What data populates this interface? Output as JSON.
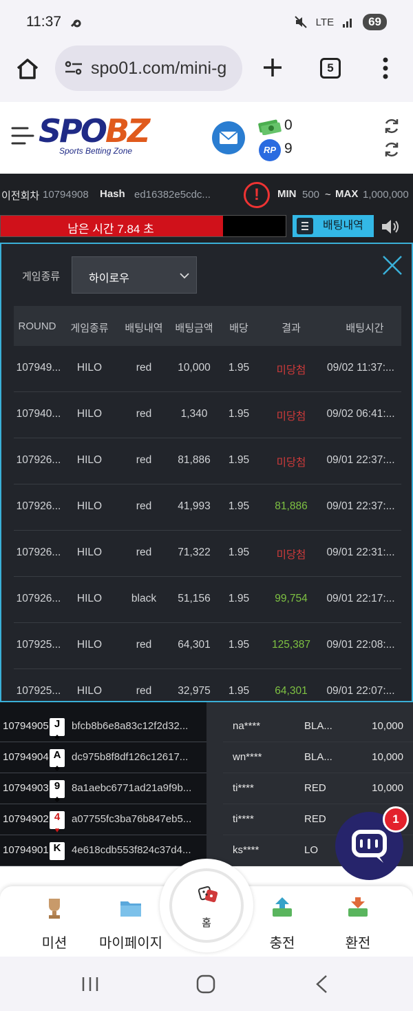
{
  "status_bar": {
    "time": "11:37",
    "network": "LTE",
    "battery": "69"
  },
  "browser": {
    "url": "spo01.com/mini-g",
    "tab_count": "5"
  },
  "header": {
    "logo_spo": "SPO",
    "logo_bz": "BZ",
    "logo_tagline": "Sports Betting Zone",
    "money_value": "0",
    "rp_icon_label": "RP",
    "rp_value": "9"
  },
  "game_info": {
    "prev_round_label": "이전회차",
    "prev_round_value": "10794908",
    "hash_label": "Hash",
    "hash_value": "ed16382e5cdc...",
    "min_label": "MIN",
    "min_value": "500",
    "range_sep": "~",
    "max_label": "MAX",
    "max_value": "1,000,000"
  },
  "timer": {
    "text": "남은 시간 7.84 초",
    "fill_fraction": 0.78
  },
  "history_button": {
    "label": "배팅내역"
  },
  "modal": {
    "game_type_label": "게임종류",
    "game_type_selected": "하이로우",
    "columns": [
      "ROUND",
      "게임종류",
      "배팅내역",
      "배팅금액",
      "배당",
      "결과",
      "배팅시간"
    ],
    "rows": [
      {
        "round": "107949...",
        "game": "HILO",
        "bet": "red",
        "amount": "10,000",
        "odds": "1.95",
        "result": "미당첨",
        "result_type": "lose",
        "time": "09/02 11:37:..."
      },
      {
        "round": "107940...",
        "game": "HILO",
        "bet": "red",
        "amount": "1,340",
        "odds": "1.95",
        "result": "미당첨",
        "result_type": "lose",
        "time": "09/02 06:41:..."
      },
      {
        "round": "107926...",
        "game": "HILO",
        "bet": "red",
        "amount": "81,886",
        "odds": "1.95",
        "result": "미당첨",
        "result_type": "lose",
        "time": "09/01 22:37:..."
      },
      {
        "round": "107926...",
        "game": "HILO",
        "bet": "red",
        "amount": "41,993",
        "odds": "1.95",
        "result": "81,886",
        "result_type": "win",
        "time": "09/01 22:37:..."
      },
      {
        "round": "107926...",
        "game": "HILO",
        "bet": "red",
        "amount": "71,322",
        "odds": "1.95",
        "result": "미당첨",
        "result_type": "lose",
        "time": "09/01 22:31:..."
      },
      {
        "round": "107926...",
        "game": "HILO",
        "bet": "black",
        "amount": "51,156",
        "odds": "1.95",
        "result": "99,754",
        "result_type": "win",
        "time": "09/01 22:17:..."
      },
      {
        "round": "107925...",
        "game": "HILO",
        "bet": "red",
        "amount": "64,301",
        "odds": "1.95",
        "result": "125,387",
        "result_type": "win",
        "time": "09/01 22:08:..."
      },
      {
        "round": "107925...",
        "game": "HILO",
        "bet": "red",
        "amount": "32,975",
        "odds": "1.95",
        "result": "64,301",
        "result_type": "win",
        "time": "09/01 22:07:..."
      }
    ]
  },
  "prev_results": [
    {
      "round": "10794905",
      "card": "J",
      "suit": "♣",
      "red": false,
      "hash": "bfcb8b6e8a83c12f2d32..."
    },
    {
      "round": "10794904",
      "card": "A",
      "suit": "♣",
      "red": false,
      "hash": "dc975b8f8df126c12617..."
    },
    {
      "round": "10794903",
      "card": "9",
      "suit": "♣",
      "red": false,
      "hash": "8a1aebc6771ad21a9f9b..."
    },
    {
      "round": "10794902",
      "card": "4",
      "suit": "♥",
      "red": true,
      "hash": "a07755fc3ba76b847eb5..."
    },
    {
      "round": "10794901",
      "card": "K",
      "suit": "",
      "red": false,
      "hash": "4e618cdb553f824c37d4..."
    }
  ],
  "live_bets": [
    {
      "user": "na****",
      "pick": "BLA...",
      "amount": "10,000"
    },
    {
      "user": "wn****",
      "pick": "BLA...",
      "amount": "10,000"
    },
    {
      "user": "ti****",
      "pick": "RED",
      "amount": "10,000"
    },
    {
      "user": "ti****",
      "pick": "RED",
      "amount": ""
    },
    {
      "user": "ks****",
      "pick": "LO",
      "amount": ""
    }
  ],
  "chat": {
    "badge": "1"
  },
  "bottom_nav": {
    "mission": "미션",
    "mypage": "마이페이지",
    "home": "홈",
    "deposit": "충전",
    "withdraw": "환전"
  },
  "colors": {
    "accent": "#3ab0d8",
    "timer_red": "#d0111a",
    "win": "#7ec142",
    "lose": "#d03a3a"
  }
}
